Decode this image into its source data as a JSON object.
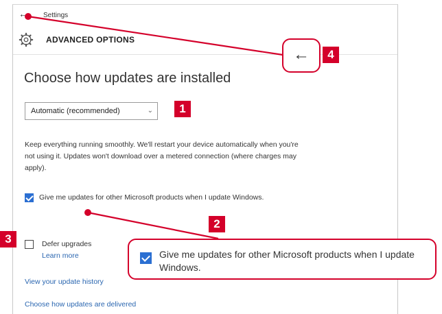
{
  "window": {
    "title": "Settings",
    "header_title": "ADVANCED OPTIONS"
  },
  "main": {
    "heading": "Choose how updates are installed",
    "dropdown_value": "Automatic (recommended)",
    "description": "Keep everything running smoothly. We'll restart your device automatically when you're not using it. Updates won't download over a metered connection (where charges may apply).",
    "checkbox_ms_updates": {
      "label": "Give me updates for other Microsoft products when I update Windows.",
      "checked": true
    },
    "checkbox_defer": {
      "label": "Defer upgrades",
      "checked": false
    },
    "learn_more": "Learn more",
    "link_history": "View your update history",
    "link_delivery": "Choose how updates are delivered"
  },
  "callouts": {
    "badge_1": "1",
    "badge_2": "2",
    "badge_3": "3",
    "badge_4": "4",
    "zoom_checkbox_label": "Give me updates for other Microsoft products when I update Windows.",
    "accent_color": "#d4002a"
  },
  "icons": [
    "back-arrow-icon",
    "gear-icon",
    "chevron-down-icon",
    "checkmark-icon"
  ]
}
